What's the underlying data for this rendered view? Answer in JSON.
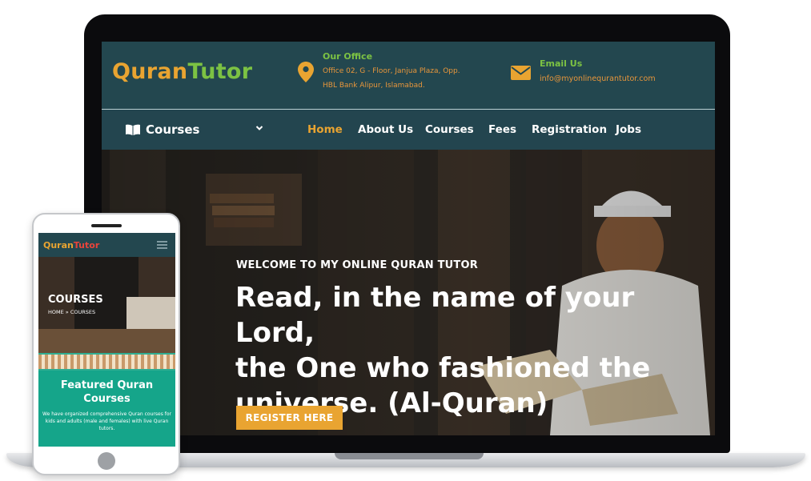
{
  "desktop": {
    "logo": {
      "part1": "Quran",
      "part2": "Tutor"
    },
    "office": {
      "title": "Our Office",
      "line1": "Office 02, G - Floor, Janjua Plaza, Opp.",
      "line2": "HBL Bank Alipur, Islamabad."
    },
    "email": {
      "title": "Email Us",
      "value": "info@myonlinequrantutor.com"
    },
    "nav": {
      "courses_dropdown": "Courses",
      "items": [
        "Home",
        "About Us",
        "Courses",
        "Fees",
        "Registration",
        "Jobs"
      ],
      "active": "Home"
    },
    "hero": {
      "subtitle": "WELCOME TO MY ONLINE QURAN TUTOR",
      "title_line1": "Read, in the name of your Lord,",
      "title_line2": "the One who fashioned the",
      "title_line3": "universe. (Al-Quran)",
      "button": "REGISTER HERE"
    }
  },
  "mobile": {
    "logo": {
      "part1": "Quran",
      "part2": "Tutor"
    },
    "banner_title": "COURSES",
    "breadcrumb": "HOME  »  COURSES",
    "feature_title_line1": "Featured Quran",
    "feature_title_line2": "Courses",
    "feature_text": "We have organized comprehensive Quran courses for kids and adults (male and females) with live Quran tutors."
  },
  "colors": {
    "header_bg": "#23474f",
    "accent_orange": "#e9a431",
    "accent_green": "#7cc243",
    "mobile_feature_bg": "#15a58a"
  }
}
